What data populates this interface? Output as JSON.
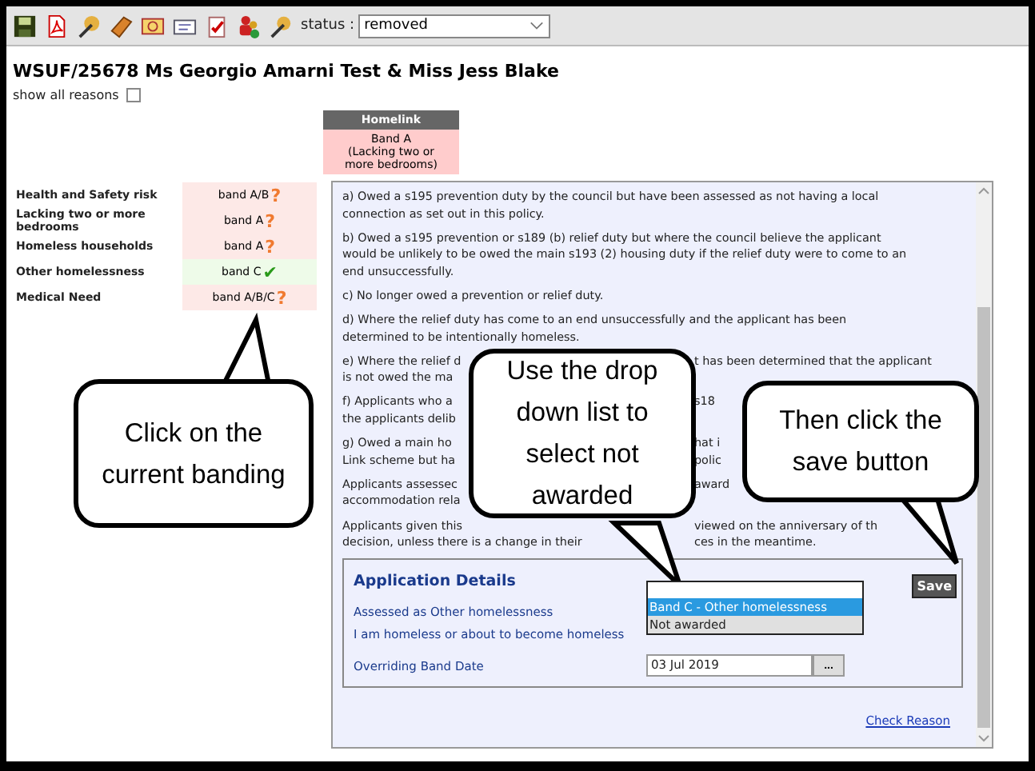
{
  "toolbar": {
    "status_label": "status :",
    "status_value": "removed"
  },
  "title": "WSUF/25678 Ms Georgio Amarni Test & Miss Jess Blake",
  "show_all_reasons": {
    "label": "show all reasons",
    "checked": false
  },
  "homelink": {
    "header": "Homelink",
    "band": "Band A",
    "reason": "(Lacking two or more bedrooms)"
  },
  "reasons": [
    {
      "label": "Health and Safety risk",
      "band": "band A/B",
      "marker": "?",
      "current": false
    },
    {
      "label": "Lacking two or more bedrooms",
      "band": "band A",
      "marker": "?",
      "current": false
    },
    {
      "label": "Homeless households",
      "band": "band A",
      "marker": "?",
      "current": false
    },
    {
      "label": "Other homelessness",
      "band": "band C",
      "marker": "✔",
      "current": true
    },
    {
      "label": "Medical Need",
      "band": "band A/B/C",
      "marker": "?",
      "current": false
    }
  ],
  "reasons_panel": {
    "paragraphs": [
      {
        "lines": [
          {
            "kind": "full",
            "text": "a) Owed a s195 prevention duty by the council but have been assessed as not having a local"
          },
          {
            "kind": "full",
            "text": "connection as set out in this policy."
          }
        ]
      },
      {
        "lines": [
          {
            "kind": "full",
            "text": "b) Owed a s195 prevention or s189 (b) relief duty but where the council believe the applicant"
          },
          {
            "kind": "full",
            "text": "would be unlikely to be owed the main s193 (2) housing duty if the relief duty were to come to an"
          },
          {
            "kind": "full",
            "text": "end unsuccessfully."
          }
        ]
      },
      {
        "lines": [
          {
            "kind": "full",
            "text": "c) No longer owed a prevention or relief duty."
          }
        ]
      },
      {
        "lines": [
          {
            "kind": "full",
            "text": "d) Where the relief duty has come to an end unsuccessfully and the applicant has been"
          },
          {
            "kind": "full",
            "text": "determined to be intentionally homeless."
          }
        ]
      },
      {
        "lines": [
          {
            "kind": "split",
            "left": "e) Where the relief d",
            "right": "t has been determined that the applicant"
          },
          {
            "kind": "split",
            "left": "is not owed the ma"
          }
        ]
      },
      {
        "lines": [
          {
            "kind": "split",
            "left": "f) Applicants who a",
            "right": "s18"
          },
          {
            "kind": "split",
            "left": "the applicants delib"
          }
        ]
      },
      {
        "lines": [
          {
            "kind": "split",
            "left": "g) Owed a main ho",
            "right": "hat i"
          },
          {
            "kind": "split",
            "left": "Link scheme but ha",
            "right": "polic"
          }
        ]
      },
      {
        "lines": [
          {
            "kind": "split",
            "left": "Applicants assessec",
            "right": "award"
          },
          {
            "kind": "split",
            "left": "accommodation rela"
          }
        ]
      },
      {
        "lines": [
          {
            "kind": "split",
            "left": "Applicants given this",
            "right": "viewed on the anniversary of th"
          },
          {
            "kind": "split",
            "left": "decision, unless there is a change in their",
            "right": "ces in the meantime."
          }
        ]
      }
    ]
  },
  "application_details": {
    "title": "Application Details",
    "save": "Save",
    "rows": [
      {
        "label": "Assessed as Other homelessness"
      },
      {
        "label": "I am homeless or about to become homeless"
      },
      {
        "label": "Overriding Band Date",
        "value": "03 Jul 2019",
        "button": "..."
      }
    ],
    "options": [
      {
        "text": "Band C - Other homelessness",
        "selected": true
      },
      {
        "text": "Not awarded",
        "selected": false
      }
    ]
  },
  "check_reason": "Check Reason",
  "callouts": [
    {
      "text": "Click on the current banding"
    },
    {
      "text": "Use the drop down list to select not awarded"
    },
    {
      "text": "Then click the save button"
    }
  ]
}
